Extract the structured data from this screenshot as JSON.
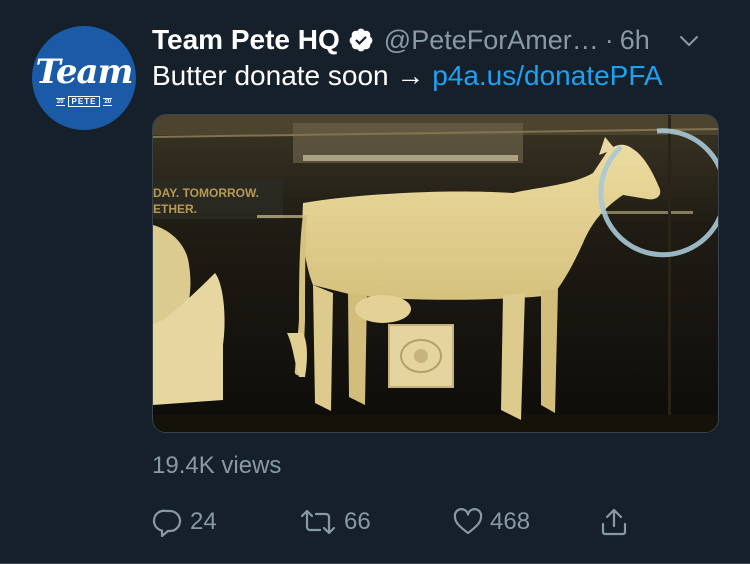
{
  "author": {
    "display_name": "Team Pete HQ",
    "handle": "@PeteForAmer…",
    "separator": "·",
    "time": "6h",
    "verified": true,
    "avatar": {
      "title": "Team",
      "year_left": "20",
      "badge": "PETE",
      "year_right": "20",
      "color": "#1a5aa6"
    }
  },
  "tweet": {
    "text": "Butter donate soon → ",
    "link": "p4a.us/donatePFA"
  },
  "media": {
    "sign_text_1": "DAY. TOMORROW.",
    "sign_text_2": "ETHER."
  },
  "stats": {
    "views": "19.4K views"
  },
  "actions": {
    "reply_count": "24",
    "retweet_count": "66",
    "like_count": "468"
  },
  "icons": {
    "verified": "verified-badge-icon",
    "chevron": "chevron-down-icon",
    "reply": "reply-icon",
    "retweet": "retweet-icon",
    "like": "heart-icon",
    "share": "share-icon"
  },
  "colors": {
    "background": "#15202b",
    "secondary_text": "#8899a6",
    "link": "#1da1f2",
    "border": "#38444d"
  }
}
